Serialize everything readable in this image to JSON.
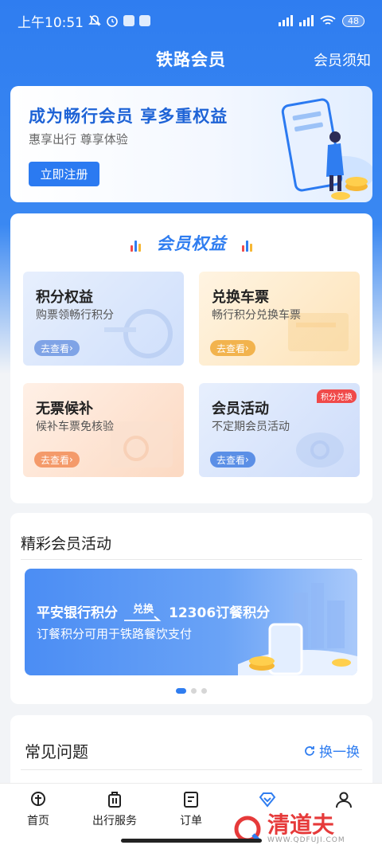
{
  "status": {
    "time": "上午10:51",
    "battery": "48"
  },
  "nav": {
    "title": "铁路会员",
    "right": "会员须知"
  },
  "banner": {
    "title": "成为畅行会员 享多重权益",
    "subtitle": "惠享出行 尊享体验",
    "button": "立即注册"
  },
  "benefits": {
    "title": "会员权益",
    "tiles": [
      {
        "title": "积分权益",
        "subtitle": "购票领畅行积分",
        "button": "去查看"
      },
      {
        "title": "兑换车票",
        "subtitle": "畅行积分兑换车票",
        "button": "去查看"
      },
      {
        "title": "无票候补",
        "subtitle": "候补车票免核验",
        "button": "去查看"
      },
      {
        "title": "会员活动",
        "subtitle": "不定期会员活动",
        "button": "去查看",
        "badge": "积分兑换"
      }
    ]
  },
  "activities": {
    "title": "精彩会员活动",
    "promo": {
      "left": "平安银行积分",
      "exchange": "兑换",
      "right": "12306订餐积分",
      "subtitle": "订餐积分可用于铁路餐饮支付"
    }
  },
  "faq": {
    "title": "常见问题",
    "refresh": "换一换"
  },
  "tabs": [
    {
      "label": "首页",
      "icon": "train-icon"
    },
    {
      "label": "出行服务",
      "icon": "luggage-icon"
    },
    {
      "label": "订单",
      "icon": "order-icon"
    },
    {
      "label": "",
      "icon": "member-diamond-icon"
    },
    {
      "label": "",
      "icon": "user-icon"
    }
  ],
  "watermark": {
    "text": "清道夫",
    "sub": "WWW.QDFUJI.COM"
  },
  "colors": {
    "primary": "#2f7df0",
    "badge": "#f04a4a"
  }
}
